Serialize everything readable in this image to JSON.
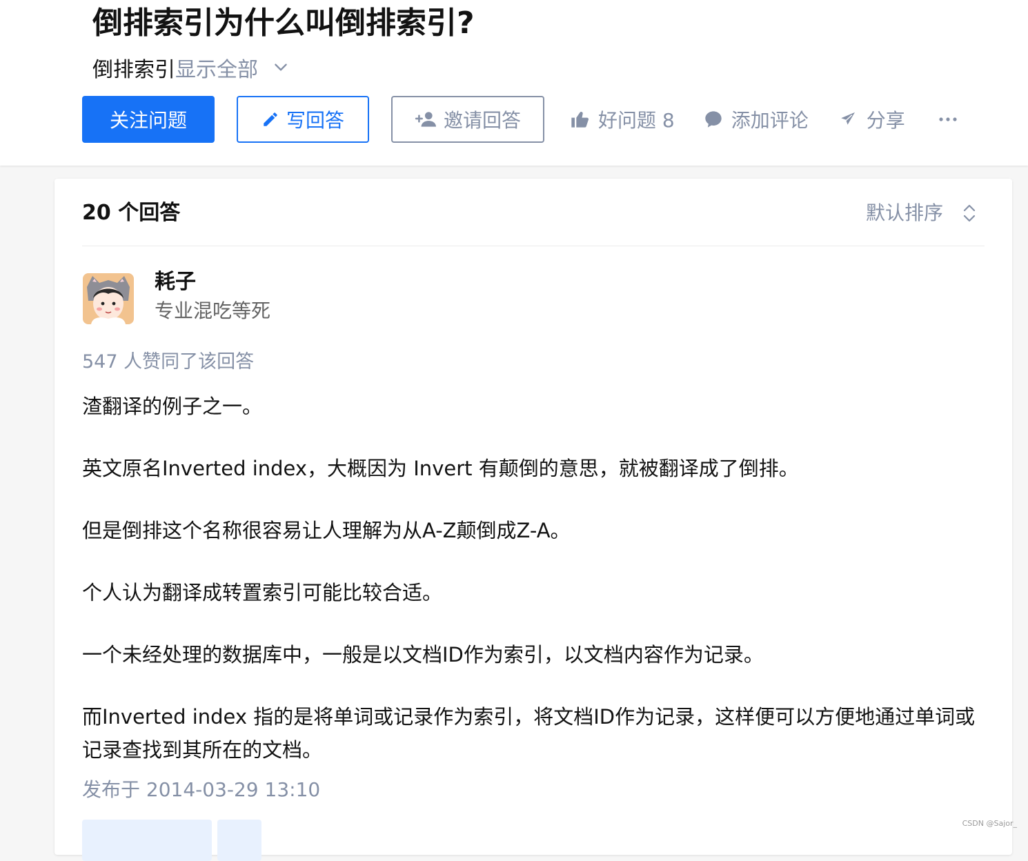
{
  "question": {
    "title": "倒排索引为什么叫倒排索引?",
    "topic": "倒排索引",
    "show_all": "显示全部"
  },
  "actions": {
    "follow": "关注问题",
    "write": "写回答",
    "invite": "邀请回答",
    "good_question": "好问题 8",
    "add_comment": "添加评论",
    "share": "分享"
  },
  "answers": {
    "count_label": "20 个回答",
    "sort_label": "默认排序"
  },
  "answer": {
    "author_name": "耗子",
    "author_bio": "专业混吃等死",
    "votes_text": "547 人赞同了该回答",
    "paragraphs": [
      "渣翻译的例子之一。",
      "英文原名Inverted index，大概因为 Invert 有颠倒的意思，就被翻译成了倒排。",
      "但是倒排这个名称很容易让人理解为从A-Z颠倒成Z-A。",
      "个人认为翻译成转置索引可能比较合适。",
      "一个未经处理的数据库中，一般是以文档ID作为索引，以文档内容作为记录。",
      "而Inverted index 指的是将单词或记录作为索引，将文档ID作为记录，这样便可以方便地通过单词或记录查找到其所在的文档。"
    ],
    "published": "发布于 2014-03-29 13:10"
  },
  "watermark": "CSDN @Sajor_",
  "colors": {
    "brand_blue": "#1772f6",
    "meta_grey": "#8590a6",
    "page_bg": "#f6f6f6"
  }
}
